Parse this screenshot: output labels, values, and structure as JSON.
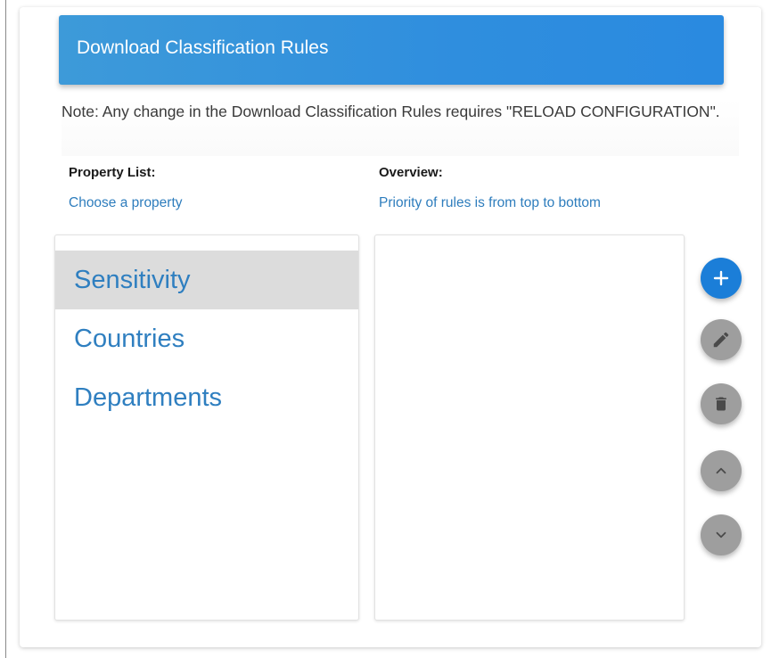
{
  "header": {
    "title": "Download Classification Rules"
  },
  "note": {
    "text": "Note: Any change in the Download Classification Rules requires \"RELOAD CONFIGURATION\"."
  },
  "property_list": {
    "label": "Property List:",
    "hint": "Choose a property",
    "items": [
      "Sensitivity",
      "Countries",
      "Departments"
    ],
    "selected": "Sensitivity"
  },
  "overview": {
    "label": "Overview:",
    "hint": "Priority of rules is from top to bottom"
  },
  "actions": {
    "add": {
      "icon": "plus-icon",
      "enabled": true,
      "color": "#1b7ed8"
    },
    "edit": {
      "icon": "pencil-icon",
      "enabled": false,
      "color": "#9e9e9e"
    },
    "delete": {
      "icon": "trash-icon",
      "enabled": false
    },
    "move_up": {
      "icon": "chevron-up-icon",
      "enabled": false
    },
    "move_down": {
      "icon": "chevron-down-icon",
      "enabled": false
    }
  }
}
